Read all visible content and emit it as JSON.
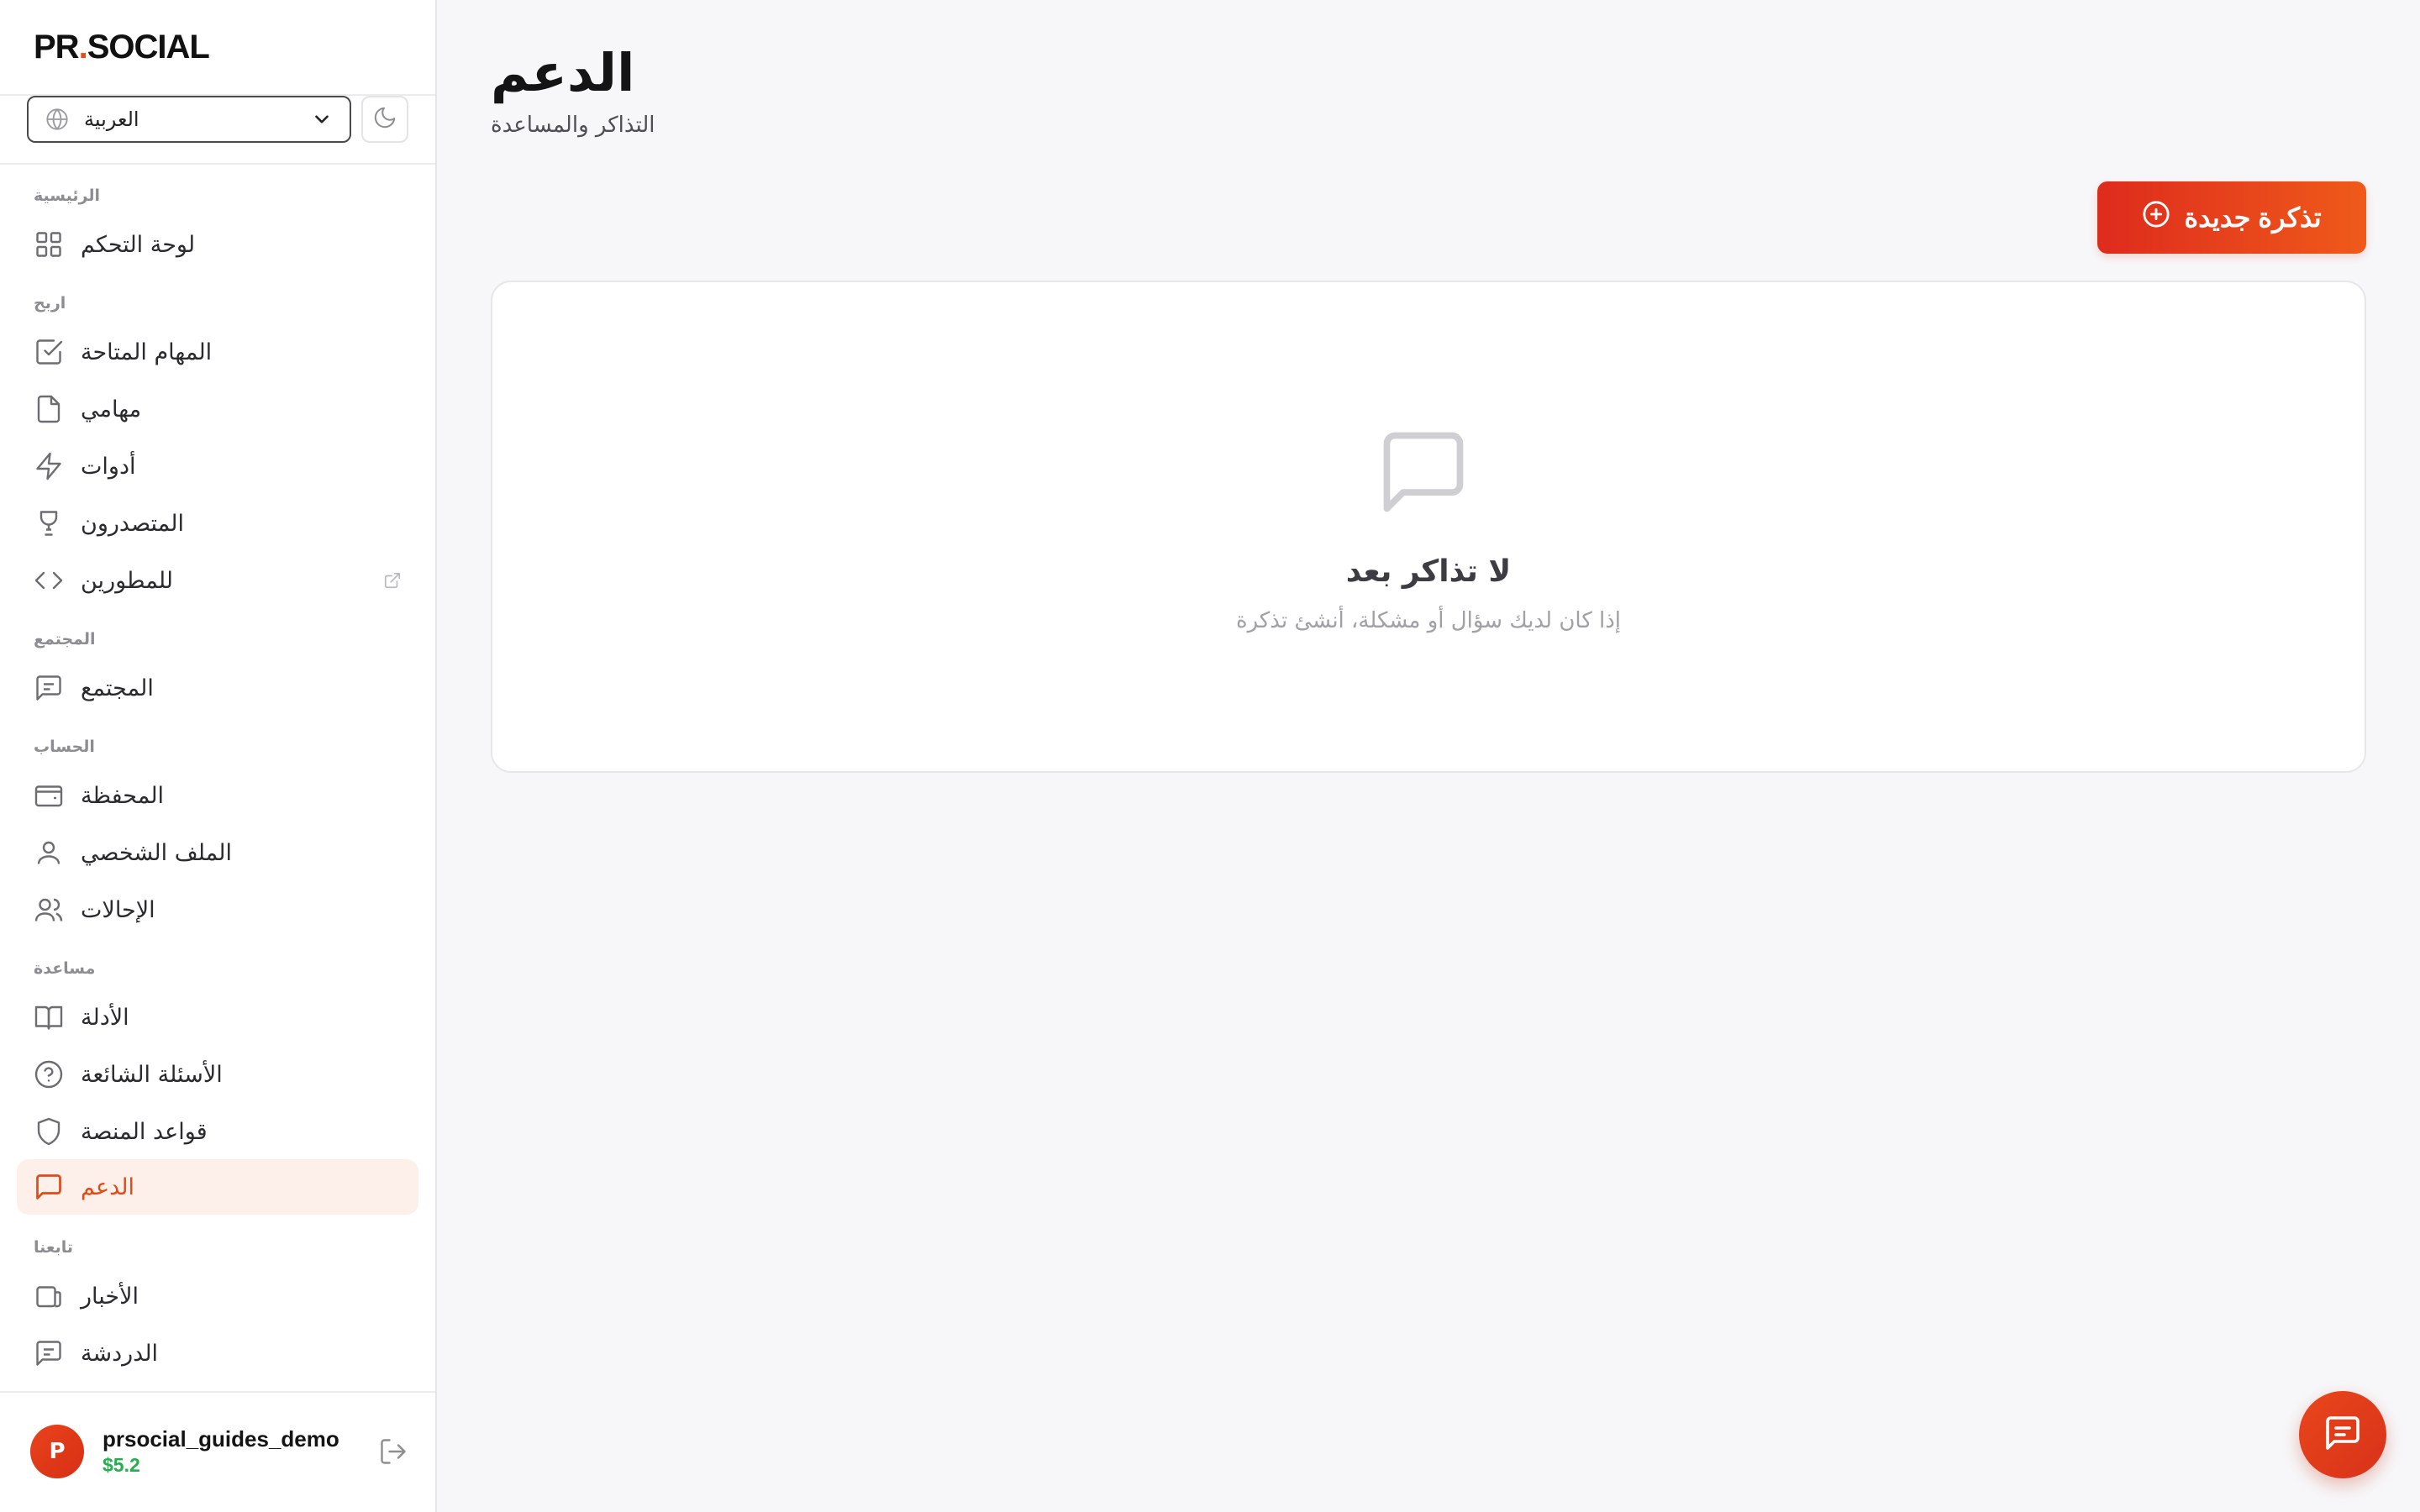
{
  "brand": {
    "logo_prefix": "PR",
    "logo_dot": ".",
    "logo_suffix": "SOCIAL"
  },
  "language": {
    "selected": "العربية"
  },
  "sidebar": {
    "sections": {
      "main": "الرئيسية",
      "earn": "اربح",
      "community": "المجتمع",
      "account": "الحساب",
      "help": "مساعدة",
      "follow": "تابعنا"
    },
    "items": {
      "dashboard": "لوحة التحكم",
      "available_tasks": "المهام المتاحة",
      "my_tasks": "مهامي",
      "tools": "أدوات",
      "leaderboard": "المتصدرون",
      "developers": "للمطورين",
      "community": "المجتمع",
      "wallet": "المحفظة",
      "profile": "الملف الشخصي",
      "referrals": "الإحالات",
      "guides": "الأدلة",
      "faq": "الأسئلة الشائعة",
      "rules": "قواعد المنصة",
      "support": "الدعم",
      "news": "الأخبار",
      "chat": "الدردشة"
    },
    "active_item": "support"
  },
  "user": {
    "avatar_letter": "P",
    "username": "prsocial_guides_demo",
    "balance": "$5.2"
  },
  "page": {
    "title": "الدعم",
    "subtitle": "التذاكر والمساعدة",
    "new_ticket_label": "تذكرة جديدة"
  },
  "empty_state": {
    "title": "لا تذاكر بعد",
    "subtitle": "إذا كان لديك سؤال أو مشكلة، أنشئ تذكرة"
  },
  "colors": {
    "accent": "#e04a16",
    "active_bg": "#fdf0ea",
    "balance_green": "#22b04b"
  },
  "icons": {
    "dashboard": "grid-icon",
    "available_tasks": "check-square-icon",
    "my_tasks": "file-icon",
    "tools": "lightning-icon",
    "leaderboard": "trophy-icon",
    "developers": "code-icon",
    "community": "message-square-icon",
    "wallet": "wallet-icon",
    "profile": "user-icon",
    "referrals": "users-icon",
    "guides": "book-icon",
    "faq": "help-circle-icon",
    "rules": "shield-icon",
    "support": "message-icon",
    "news": "newspaper-icon",
    "chat": "chat-icon"
  }
}
